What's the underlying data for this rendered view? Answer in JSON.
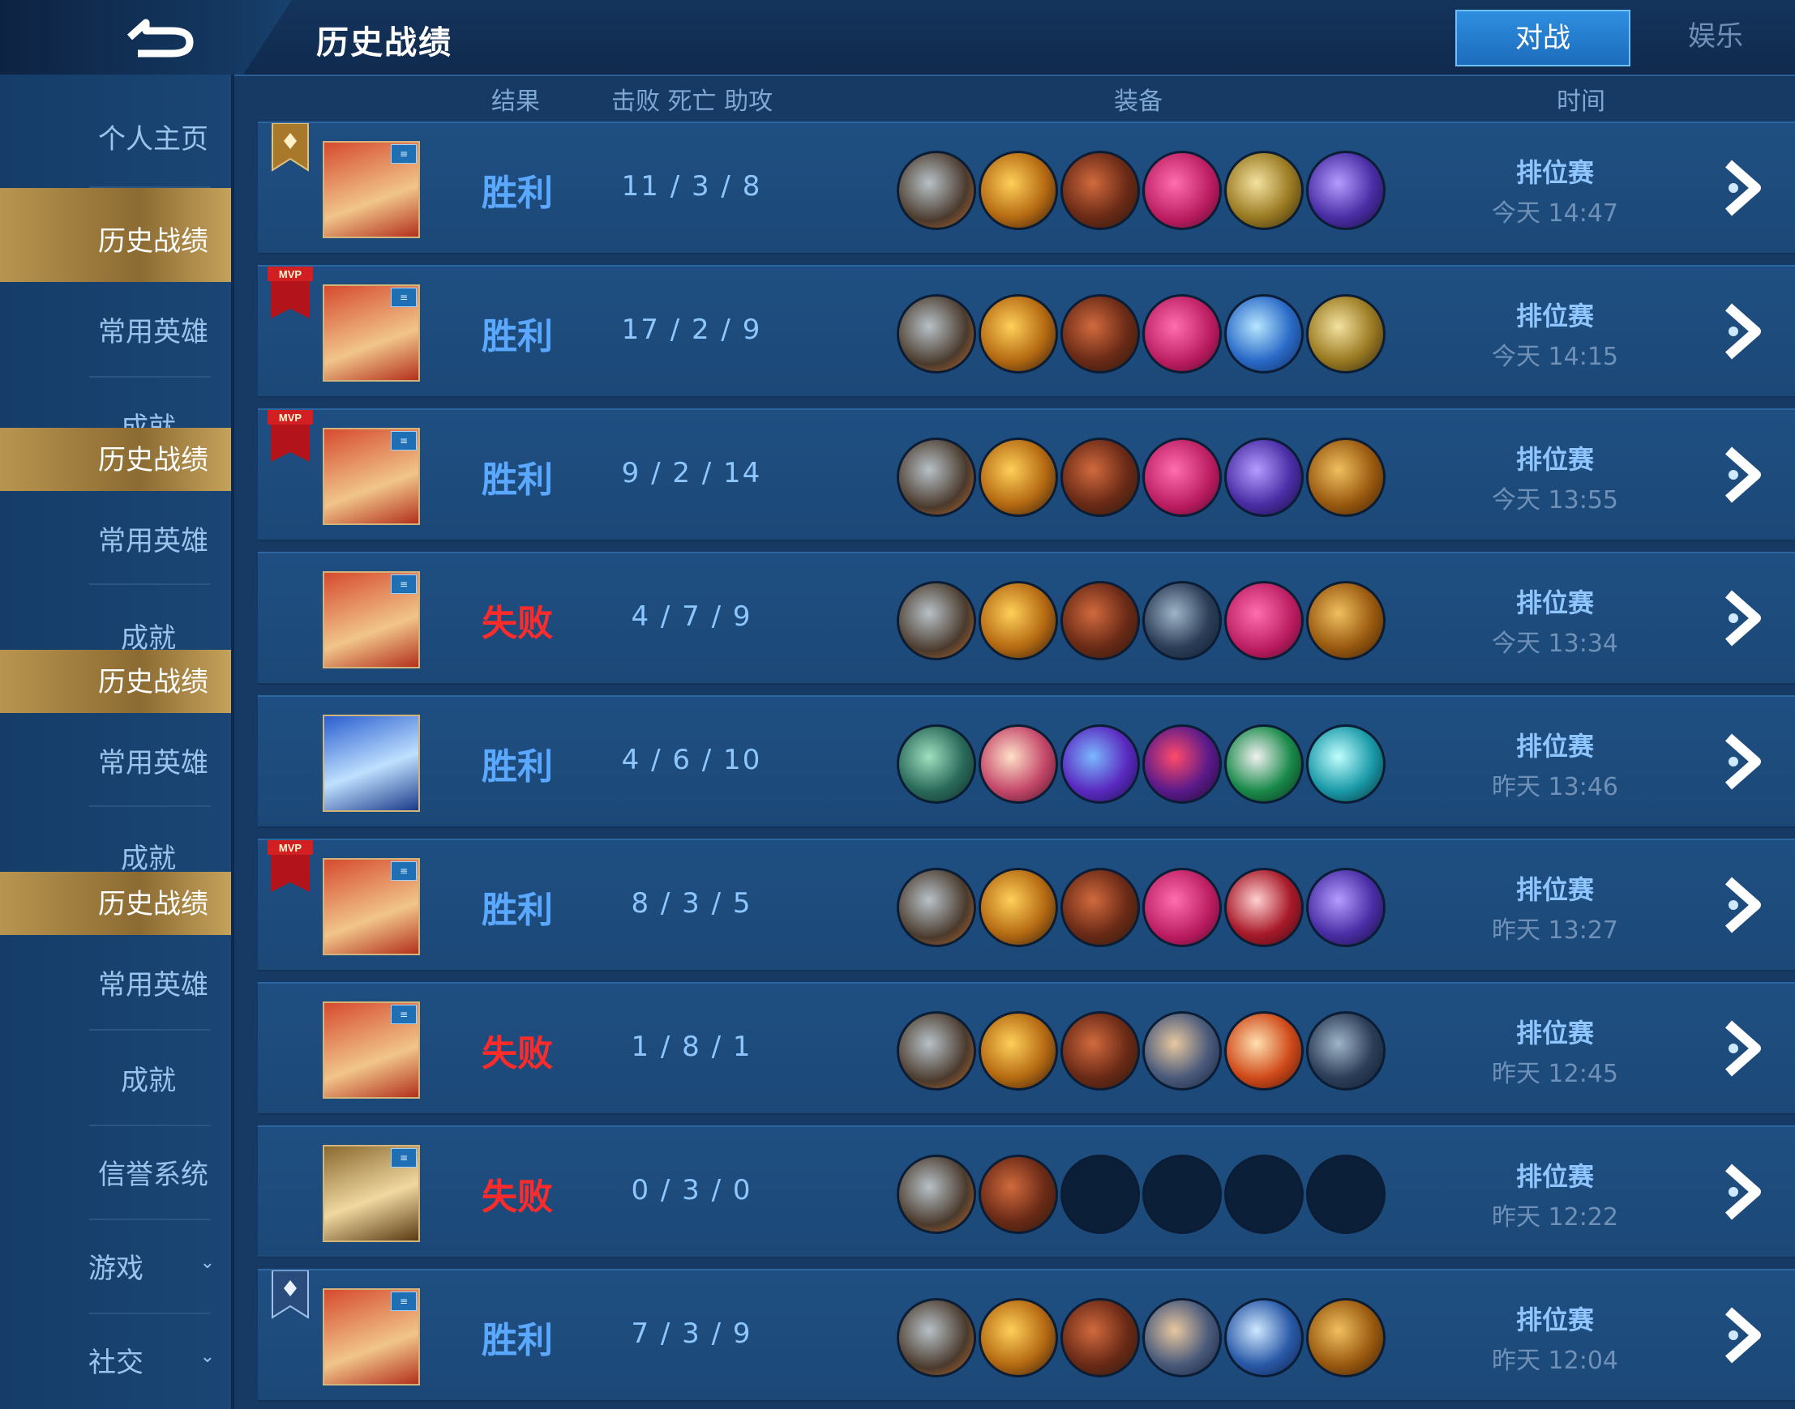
{
  "header": {
    "title": "历史战绩",
    "tabs": [
      "对战",
      "娱乐"
    ]
  },
  "sidebar": {
    "items": [
      {
        "label": "个人主页"
      },
      {
        "label": "历史战绩"
      },
      {
        "label": "常用英雄"
      },
      {
        "label": "成就"
      },
      {
        "label": "历史战绩"
      },
      {
        "label": "常用英雄"
      },
      {
        "label": "成就"
      },
      {
        "label": "历史战绩"
      },
      {
        "label": "常用英雄"
      },
      {
        "label": "成就"
      },
      {
        "label": "历史战绩"
      },
      {
        "label": "常用英雄"
      },
      {
        "label": "成就"
      },
      {
        "label": "信誉系统"
      },
      {
        "label": "游戏"
      },
      {
        "label": "社交"
      }
    ]
  },
  "columns": {
    "result": "结果",
    "kda": "击败  死亡  助攻",
    "items": "装备",
    "time": "时间"
  },
  "matches": [
    {
      "result": "胜利",
      "kda": "11 / 3 / 8",
      "mode": "排位赛",
      "time": "今天 14:47"
    },
    {
      "result": "胜利",
      "kda": "17 / 2 / 9",
      "mode": "排位赛",
      "time": "今天 14:15"
    },
    {
      "result": "胜利",
      "kda": "9 / 2 / 14",
      "mode": "排位赛",
      "time": "今天 13:55"
    },
    {
      "result": "失败",
      "kda": "4 / 7 / 9",
      "mode": "排位赛",
      "time": "今天 13:34"
    },
    {
      "result": "胜利",
      "kda": "4 / 6 / 10",
      "mode": "排位赛",
      "time": "昨天 13:46"
    },
    {
      "result": "胜利",
      "kda": "8 / 3 / 5",
      "mode": "排位赛",
      "time": "昨天 13:27"
    },
    {
      "result": "失败",
      "kda": "1 / 8 / 1",
      "mode": "排位赛",
      "time": "昨天 12:45"
    },
    {
      "result": "失败",
      "kda": "0 / 3 / 0",
      "mode": "排位赛",
      "time": "昨天 12:22"
    },
    {
      "result": "胜利",
      "kda": "7 / 3 / 9",
      "mode": "排位赛",
      "time": "昨天 12:04"
    }
  ],
  "badges": {
    "mvp": "MVP"
  },
  "colors": {
    "win": "#5aa8ff",
    "lose": "#ff2b2b",
    "accent_gold": "#b8954f",
    "active_tab": "#2f8ee0"
  }
}
